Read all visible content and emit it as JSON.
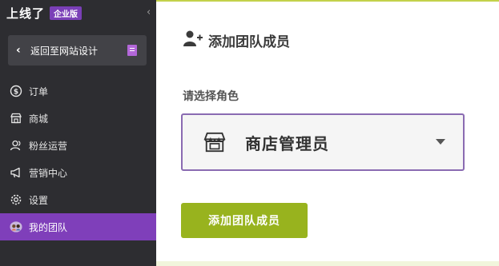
{
  "brand": {
    "name": "上线了",
    "badge": "企业版"
  },
  "sidebar": {
    "collapse_icon": "chevron-left-icon",
    "back_label": "返回至网站设计",
    "items": [
      {
        "label": "订单",
        "icon": "dollar-circle-icon",
        "active": false
      },
      {
        "label": "商城",
        "icon": "store-icon",
        "active": false
      },
      {
        "label": "粉丝运营",
        "icon": "users-icon",
        "active": false
      },
      {
        "label": "营销中心",
        "icon": "megaphone-icon",
        "active": false
      },
      {
        "label": "设置",
        "icon": "gear-icon",
        "active": false
      },
      {
        "label": "我的团队",
        "icon": "team-avatar-icon",
        "active": true
      }
    ]
  },
  "main": {
    "title": "添加团队成员",
    "title_icon": "add-user-icon",
    "role_label": "请选择角色",
    "role_value": "商店管理员",
    "role_icon": "store-icon",
    "submit_label": "添加团队成员"
  },
  "colors": {
    "sidebar_bg": "#2d2d31",
    "accent_purple": "#7f3fba",
    "button_green": "#98b31e",
    "select_border": "#8a6bb2"
  }
}
